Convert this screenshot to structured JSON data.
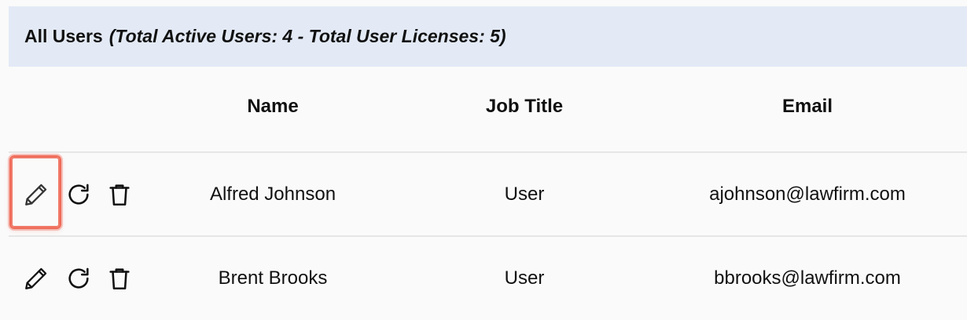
{
  "header": {
    "title": "All Users",
    "subtitle": "(Total Active Users: 4 - Total User Licenses: 5)"
  },
  "columns": {
    "name": "Name",
    "job_title": "Job Title",
    "email": "Email"
  },
  "rows": [
    {
      "name": "Alfred Johnson",
      "job_title": "User",
      "email": "ajohnson@lawfirm.com"
    },
    {
      "name": "Brent Brooks",
      "job_title": "User",
      "email": "bbrooks@lawfirm.com"
    }
  ],
  "icons": {
    "edit": "pencil-icon",
    "reset": "refresh-icon",
    "delete": "trash-icon"
  },
  "colors": {
    "header_bg": "#e3eaf6",
    "highlight": "#ee6a58"
  }
}
